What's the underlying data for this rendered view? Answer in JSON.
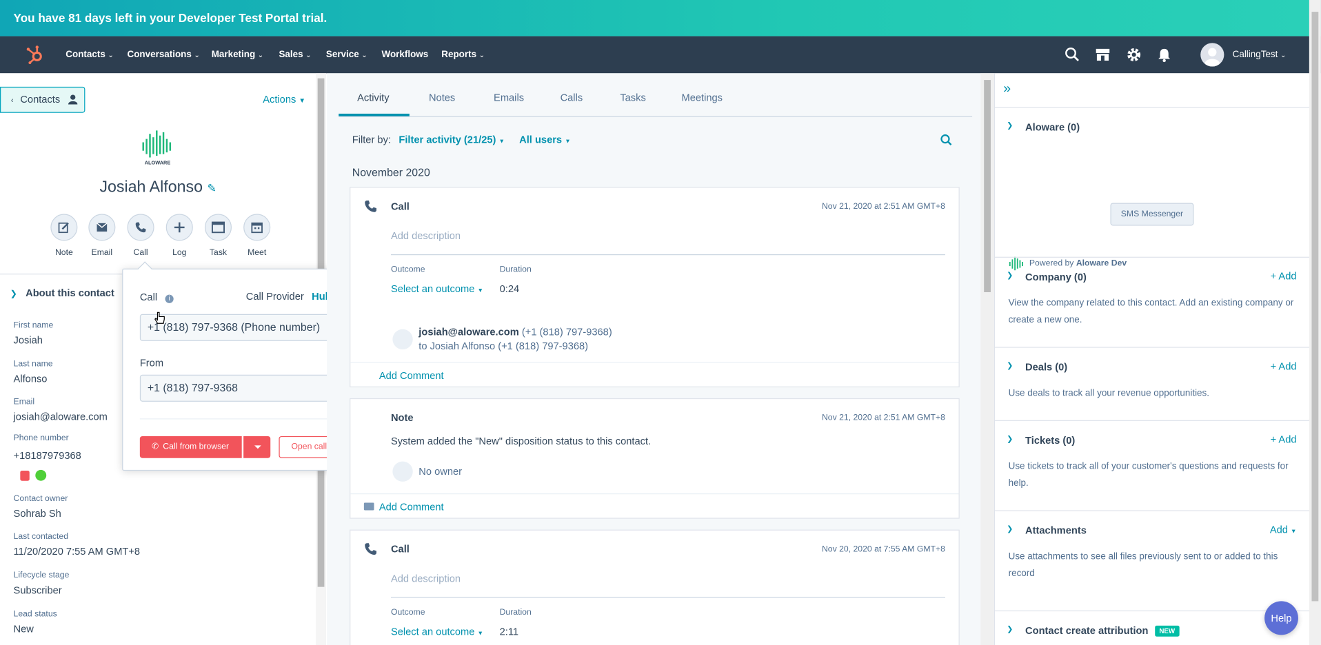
{
  "banner": {
    "text": "You have 81 days left in your Developer Test Portal trial."
  },
  "topnav": {
    "items": [
      {
        "label": "Contacts",
        "chevron": true
      },
      {
        "label": "Conversations",
        "chevron": true
      },
      {
        "label": "Marketing",
        "chevron": true
      },
      {
        "label": "Sales",
        "chevron": true
      },
      {
        "label": "Service",
        "chevron": true
      },
      {
        "label": "Workflows",
        "chevron": false
      },
      {
        "label": "Reports",
        "chevron": true
      }
    ],
    "user_name": "CallingTest",
    "icons": [
      "hubspot-sprocket-icon",
      "search-icon",
      "marketplace-icon",
      "gear-icon",
      "bell-icon"
    ]
  },
  "left": {
    "contacts_button": "Contacts",
    "actions": "Actions",
    "company_logo_text": "ALOWARE",
    "contact_name": "Josiah Alfonso",
    "quick_actions": [
      "Note",
      "Email",
      "Call",
      "Log",
      "Task",
      "Meet"
    ],
    "about_header": "About this contact",
    "fields": [
      {
        "label": "First name",
        "value": "Josiah"
      },
      {
        "label": "Last name",
        "value": "Alfonso"
      },
      {
        "label": "Email",
        "value": "josiah@aloware.com"
      },
      {
        "label": "Phone number",
        "value": "+18187979368"
      },
      {
        "label": "Contact owner",
        "value": "Sohrab Sh"
      },
      {
        "label": "Last contacted",
        "value": "11/20/2020 7:55 AM GMT+8"
      },
      {
        "label": "Lifecycle stage",
        "value": "Subscriber"
      },
      {
        "label": "Lead status",
        "value": "New"
      }
    ]
  },
  "call_popover": {
    "title": "Call",
    "provider_label": "Call Provider",
    "provider_value": "HubSpot",
    "to_value": "+1 (818) 797-9368 (Phone number)",
    "from_label": "From",
    "from_value": "+1 (818) 797-9368",
    "call_button": "Call from browser",
    "notes_button": "Open call notes"
  },
  "activity": {
    "tabs": [
      "Activity",
      "Notes",
      "Emails",
      "Calls",
      "Tasks",
      "Meetings"
    ],
    "active_tab": "Activity",
    "filter_label": "Filter by:",
    "filter_activity": "Filter activity (21/25)",
    "filter_users": "All users",
    "month": "November 2020",
    "cards": [
      {
        "type": "Call",
        "date": "Nov 21, 2020 at 2:51 AM GMT+8",
        "description_placeholder": "Add description",
        "outcome_label": "Outcome",
        "outcome_value": "Select an outcome",
        "duration_label": "Duration",
        "duration_value": "0:24",
        "from_email": "josiah@aloware.com",
        "from_phone": "(+1 (818) 797-9368)",
        "to_line": "to Josiah Alfonso (+1 (818) 797-9368)",
        "add_comment": "Add Comment"
      },
      {
        "type": "Note",
        "date": "Nov 21, 2020 at 2:51 AM GMT+8",
        "body": "System added the \"New\" disposition status to this contact.",
        "owner": "No owner",
        "add_comment": "Add Comment"
      },
      {
        "type": "Call",
        "date": "Nov 20, 2020 at 7:55 AM GMT+8",
        "description_placeholder": "Add description",
        "outcome_label": "Outcome",
        "outcome_value": "Select an outcome",
        "duration_label": "Duration",
        "duration_value": "2:11"
      }
    ]
  },
  "right": {
    "sections": [
      {
        "title": "Aloware (0)",
        "add": ""
      },
      {
        "title": "Company (0)",
        "add": "+ Add",
        "body": "View the company related to this contact. Add an existing company or create a new one."
      },
      {
        "title": "Deals (0)",
        "add": "+ Add",
        "body": "Use deals to track all your revenue opportunities."
      },
      {
        "title": "Tickets (0)",
        "add": "+ Add",
        "body": "Use tickets to track all of your customer's questions and requests for help."
      },
      {
        "title": "Attachments",
        "add": "Add",
        "body": "Use attachments to see all files previously sent to or added to this record"
      },
      {
        "title": "Contact create attribution",
        "badge": "NEW"
      }
    ],
    "sms_button": "SMS Messenger",
    "powered_by": "Powered by",
    "powered_name": "Aloware Dev",
    "help": "Help"
  },
  "colors": {
    "accent": "#0091ae",
    "nav_bg": "#2d3e50",
    "call_button": "#f2545b",
    "banner": "#21c8b4"
  }
}
